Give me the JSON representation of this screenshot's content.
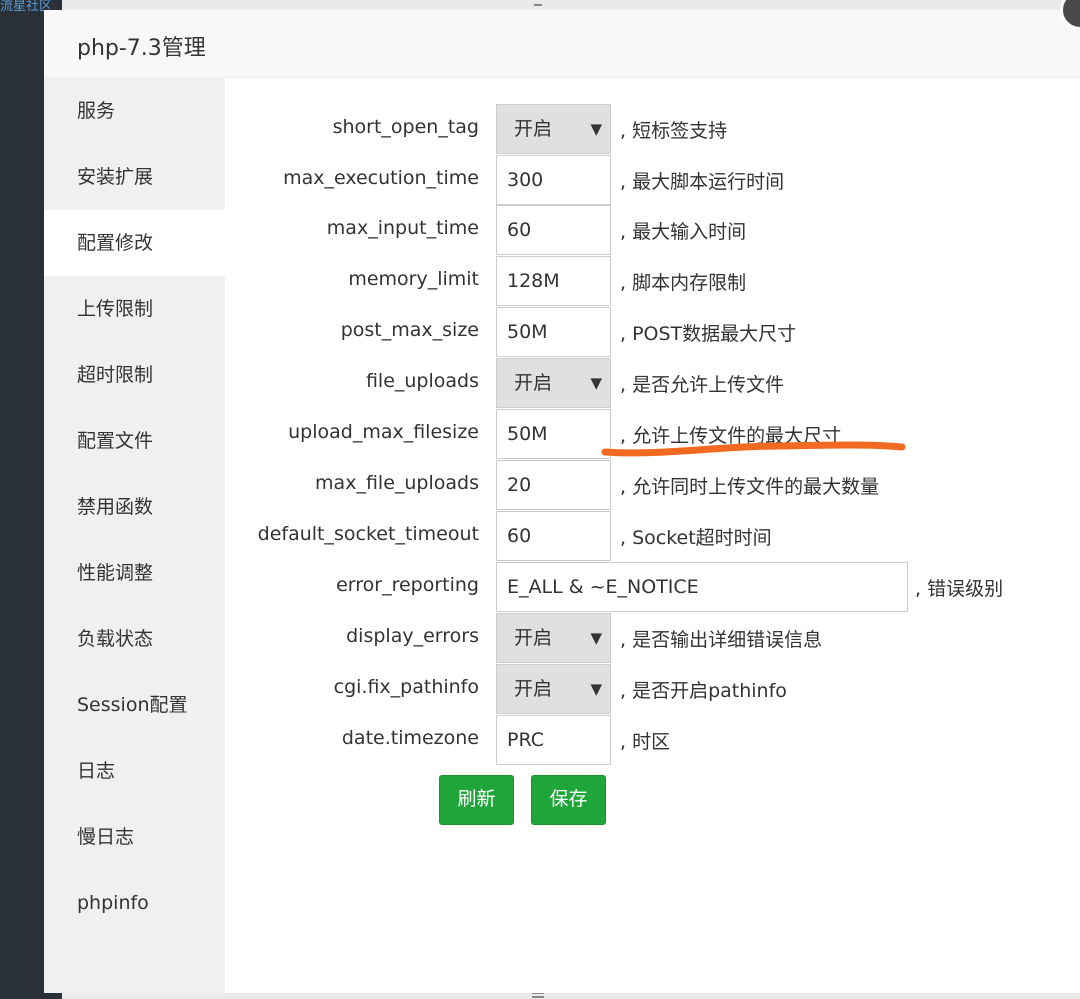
{
  "background": {
    "corner_link": "流星社区"
  },
  "modal": {
    "title": "php-7.3管理"
  },
  "sidebar": {
    "items": [
      {
        "label": "服务"
      },
      {
        "label": "安装扩展"
      },
      {
        "label": "配置修改",
        "active": true
      },
      {
        "label": "上传限制"
      },
      {
        "label": "超时限制"
      },
      {
        "label": "配置文件"
      },
      {
        "label": "禁用函数"
      },
      {
        "label": "性能调整"
      },
      {
        "label": "负载状态"
      },
      {
        "label": "Session配置"
      },
      {
        "label": "日志"
      },
      {
        "label": "慢日志"
      },
      {
        "label": "phpinfo"
      }
    ]
  },
  "config": {
    "rows": [
      {
        "key": "short_open_tag",
        "type": "select",
        "value": "开启",
        "desc": ", 短标签支持"
      },
      {
        "key": "max_execution_time",
        "type": "input",
        "value": "300",
        "desc": ", 最大脚本运行时间"
      },
      {
        "key": "max_input_time",
        "type": "input",
        "value": "60",
        "desc": ", 最大输入时间"
      },
      {
        "key": "memory_limit",
        "type": "input",
        "value": "128M",
        "desc": ", 脚本内存限制"
      },
      {
        "key": "post_max_size",
        "type": "input",
        "value": "50M",
        "desc": ", POST数据最大尺寸"
      },
      {
        "key": "file_uploads",
        "type": "select",
        "value": "开启",
        "desc": ", 是否允许上传文件"
      },
      {
        "key": "upload_max_filesize",
        "type": "input",
        "value": "50M",
        "desc": ", 允许上传文件的最大尺寸"
      },
      {
        "key": "max_file_uploads",
        "type": "input",
        "value": "20",
        "desc": ", 允许同时上传文件的最大数量"
      },
      {
        "key": "default_socket_timeout",
        "type": "input",
        "value": "60",
        "desc": ", Socket超时时间"
      },
      {
        "key": "error_reporting",
        "type": "wide",
        "value": "E_ALL & ~E_NOTICE",
        "desc": ", 错误级别"
      },
      {
        "key": "display_errors",
        "type": "select",
        "value": "开启",
        "desc": ", 是否输出详细错误信息"
      },
      {
        "key": "cgi.fix_pathinfo",
        "type": "select",
        "value": "开启",
        "desc": ", 是否开启pathinfo"
      },
      {
        "key": "date.timezone",
        "type": "input",
        "value": "PRC",
        "desc": ", 时区"
      }
    ],
    "select_arrow": "▼"
  },
  "buttons": {
    "refresh": "刷新",
    "save": "保存"
  },
  "colors": {
    "accent_green": "#20a53a",
    "annotation_orange": "#f26a21"
  }
}
